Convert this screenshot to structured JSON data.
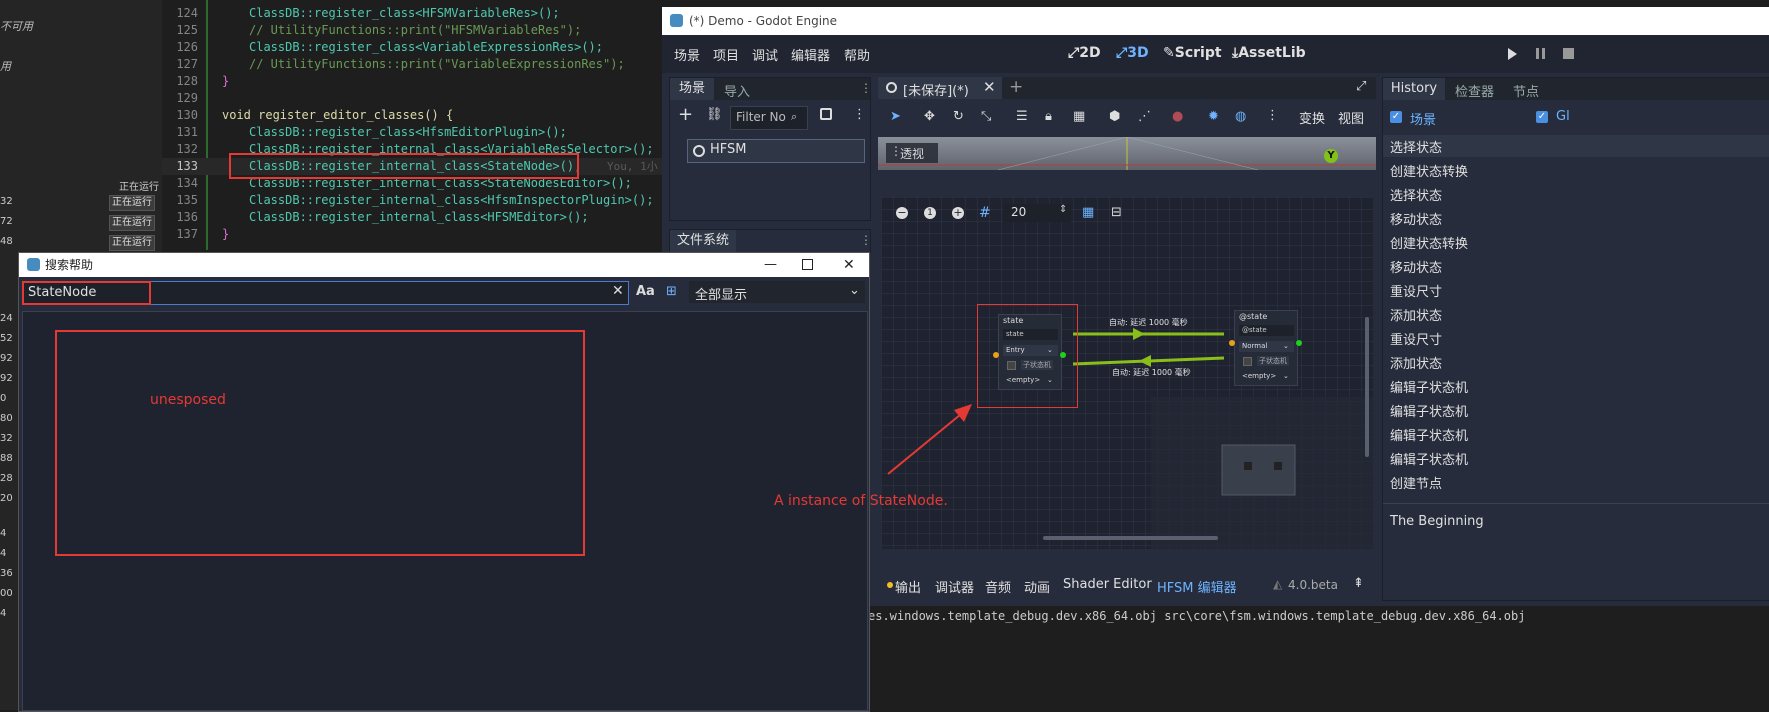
{
  "left_panel": {
    "notes": [
      "不可用",
      "用"
    ],
    "running_label": "正在运行",
    "rows": [
      "32",
      "72",
      "48"
    ],
    "badges": [
      "正在运行",
      "正在运行",
      "正在运行"
    ],
    "more_nums": [
      "24",
      "52",
      "92",
      "92",
      "0",
      "80",
      "32",
      "88",
      "28",
      "20",
      "4",
      "4",
      "36",
      "00",
      "4"
    ]
  },
  "code": {
    "lines": [
      {
        "n": "124",
        "t": "ClassDB::register_class<HFSMVariableRes>();"
      },
      {
        "n": "125",
        "t": "// UtilityFunctions::print(\"HFSMVariableRes\");"
      },
      {
        "n": "126",
        "t": "ClassDB::register_class<VariableExpressionRes>();"
      },
      {
        "n": "127",
        "t": "// UtilityFunctions::print(\"VariableExpressionRes\");"
      },
      {
        "n": "128",
        "t": "}"
      },
      {
        "n": "129",
        "t": ""
      },
      {
        "n": "130",
        "t": "void register_editor_classes() {"
      },
      {
        "n": "131",
        "t": "ClassDB::register_class<HfsmEditorPlugin>();"
      },
      {
        "n": "132",
        "t": "ClassDB::register_internal_class<VariableResSelector>();"
      },
      {
        "n": "133",
        "t": "ClassDB::register_internal_class<StateNode>();"
      },
      {
        "n": "134",
        "t": "ClassDB::register_internal_class<StateNodesEditor>();"
      },
      {
        "n": "135",
        "t": "ClassDB::register_internal_class<HfsmInspectorPlugin>();"
      },
      {
        "n": "136",
        "t": "ClassDB::register_internal_class<HFSMEditor>();"
      },
      {
        "n": "137",
        "t": "}"
      }
    ],
    "blame": "You, 1小"
  },
  "godot": {
    "title": "(*) Demo - Godot Engine",
    "menus": [
      "场景",
      "项目",
      "调试",
      "编辑器",
      "帮助"
    ],
    "workspaces": [
      "2D",
      "3D",
      "Script",
      "AssetLib"
    ],
    "scene_dock": {
      "tabs": [
        "场景",
        "导入"
      ],
      "filter_placeholder": "Filter No",
      "root_node": "HFSM"
    },
    "fs_dock": {
      "tab": "文件系统"
    },
    "viewport": {
      "tab": "[未保存](*)",
      "toolbar_text": [
        "变换",
        "视图"
      ],
      "perspective": "透视",
      "gizmo_axis": "Y"
    },
    "graph": {
      "zoom_value": "20",
      "node_left": {
        "title": "state",
        "name": "state",
        "type": "Entry",
        "child": "子状态机",
        "empty": "<empty>"
      },
      "node_right": {
        "title": "@state",
        "name": "@state",
        "type": "Normal",
        "child": "子状态机",
        "empty": "<empty>"
      },
      "transition_top": "自动: 延迟 1000 毫秒",
      "transition_bottom": "自动: 延迟 1000 毫秒"
    },
    "bottom_tabs": [
      "输出",
      "调试器",
      "音频",
      "动画",
      "Shader Editor",
      "HFSM 编辑器"
    ],
    "version": "4.0.beta",
    "right_dock": {
      "tabs": [
        "History",
        "检查器",
        "节点"
      ],
      "check_scene": "场景",
      "check_gl": "Gl",
      "history": [
        "选择状态",
        "创建状态转换",
        "选择状态",
        "移动状态",
        "创建状态转换",
        "移动状态",
        "重设尺寸",
        "添加状态",
        "重设尺寸",
        "添加状态",
        "编辑子状态机",
        "编辑子状态机",
        "编辑子状态机",
        "编辑子状态机",
        "创建节点"
      ],
      "footer": "The Beginning"
    }
  },
  "search": {
    "title": "搜索帮助",
    "query": "StateNode",
    "filter": "全部显示",
    "case_label": "Aa"
  },
  "annotations": {
    "unexposed": "unesposed",
    "instance": "A instance of StateNode.",
    "color": "#e53935"
  },
  "console": {
    "line1": "es.windows.template_debug.dev.x86_64.obj src\\core\\fsm.windows.template_debug.dev.x86_64.obj"
  }
}
